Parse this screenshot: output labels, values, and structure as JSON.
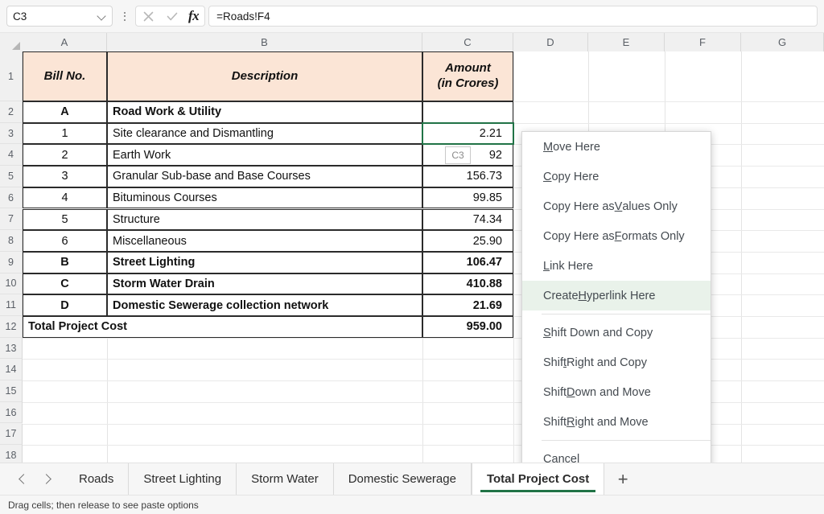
{
  "formula_bar": {
    "name_box_value": "C3",
    "formula_value": "=Roads!F4",
    "cancel_icon": "close-icon",
    "confirm_icon": "check-icon",
    "function_icon": "fx"
  },
  "grid": {
    "column_headers": [
      "A",
      "B",
      "C",
      "D",
      "E",
      "F",
      "G"
    ],
    "row_headers": [
      "1",
      "2",
      "3",
      "4",
      "5",
      "6",
      "7",
      "8",
      "9",
      "10",
      "11",
      "12",
      "13",
      "14",
      "15",
      "16",
      "17",
      "18"
    ],
    "table_header": {
      "bill_no": "Bill No.",
      "description": "Description",
      "amount_line1": "Amount",
      "amount_line2": "(in Crores)"
    },
    "rows": [
      {
        "row": "2",
        "bill": "A",
        "desc": "Road Work & Utility",
        "amount": "",
        "bold": true
      },
      {
        "row": "3",
        "bill": "1",
        "desc": "Site clearance and Dismantling",
        "amount": "2.21",
        "bold": false
      },
      {
        "row": "4",
        "bill": "2",
        "desc": "Earth Work",
        "amount": "92",
        "bold": false
      },
      {
        "row": "5",
        "bill": "3",
        "desc": "Granular Sub-base and Base Courses",
        "amount": "156.73",
        "bold": false
      },
      {
        "row": "6",
        "bill": "4",
        "desc": "Bituminous Courses",
        "amount": "99.85",
        "bold": false
      },
      {
        "row": "7",
        "bill": "5",
        "desc": "Structure",
        "amount": "74.34",
        "bold": false
      },
      {
        "row": "8",
        "bill": "6",
        "desc": "Miscellaneous",
        "amount": "25.90",
        "bold": false
      },
      {
        "row": "9",
        "bill": "B",
        "desc": "Street Lighting",
        "amount": "106.47",
        "bold": true
      },
      {
        "row": "10",
        "bill": "C",
        "desc": "Storm Water Drain",
        "amount": "410.88",
        "bold": true
      },
      {
        "row": "11",
        "bill": "D",
        "desc": "Domestic Sewerage collection network",
        "amount": "21.69",
        "bold": true
      }
    ],
    "total_row": {
      "row": "12",
      "label": "Total Project Cost",
      "amount": "959.00"
    },
    "selected_cell": "C3",
    "drag_tooltip": "C3",
    "header_fill": "#FBE5D6",
    "selection_color": "#217346"
  },
  "context_menu": {
    "items": [
      {
        "label": "Move Here",
        "accel": "M",
        "highlighted": false,
        "separator_after": false
      },
      {
        "label": "Copy Here",
        "accel": "C",
        "highlighted": false,
        "separator_after": false
      },
      {
        "label": "Copy Here as Values Only",
        "accel": "V",
        "highlighted": false,
        "separator_after": false
      },
      {
        "label": "Copy Here as Formats Only",
        "accel": "F",
        "highlighted": false,
        "separator_after": false
      },
      {
        "label": "Link Here",
        "accel": "L",
        "highlighted": false,
        "separator_after": false
      },
      {
        "label": "Create Hyperlink Here",
        "accel": "H",
        "highlighted": true,
        "separator_after": true
      },
      {
        "label": "Shift Down and Copy",
        "accel": "S",
        "highlighted": false,
        "separator_after": false
      },
      {
        "label": "Shift Right and Copy",
        "accel": "t",
        "highlighted": false,
        "separator_after": false
      },
      {
        "label": "Shift Down and Move",
        "accel": "D",
        "highlighted": false,
        "separator_after": false
      },
      {
        "label": "Shift Right and Move",
        "accel": "R",
        "highlighted": false,
        "separator_after": true
      },
      {
        "label": "Cancel",
        "accel": "a",
        "highlighted": false,
        "separator_after": false
      }
    ],
    "highlight_color": "#E9F2EA"
  },
  "sheet_tabs": {
    "prev_label": "prev-sheet",
    "next_label": "next-sheet",
    "tabs": [
      {
        "label": "Roads",
        "active": false
      },
      {
        "label": "Street Lighting",
        "active": false
      },
      {
        "label": "Storm Water",
        "active": false
      },
      {
        "label": "Domestic Sewerage",
        "active": false
      },
      {
        "label": "Total Project Cost",
        "active": true
      }
    ],
    "add_label": "+"
  },
  "status_bar": {
    "message": "Drag cells; then release to see paste options"
  }
}
